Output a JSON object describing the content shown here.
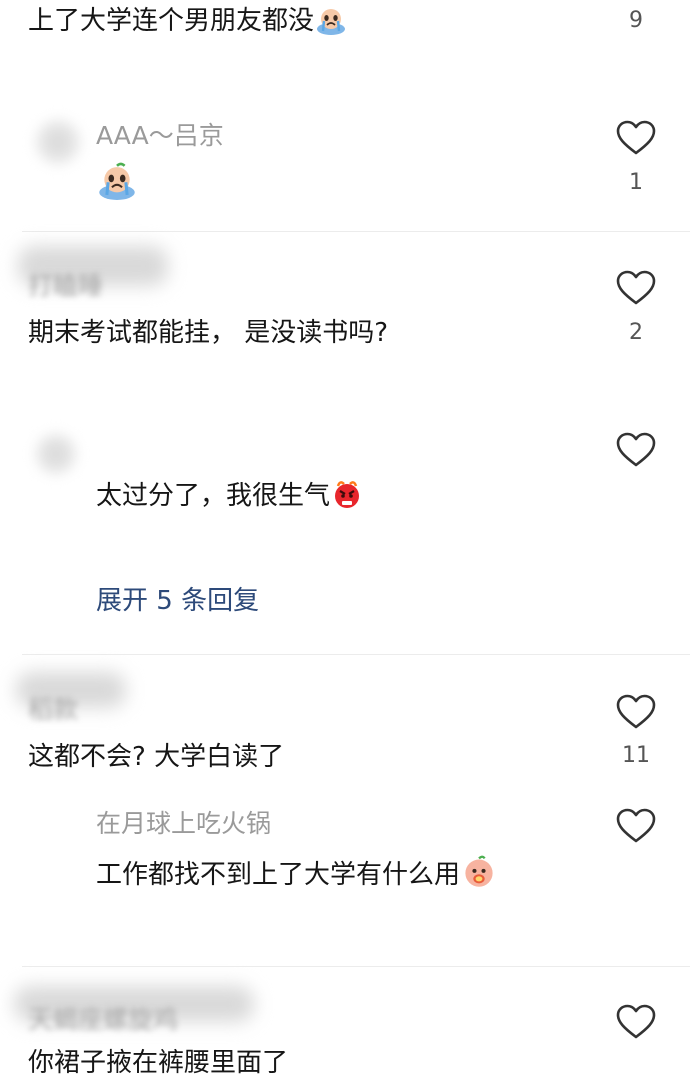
{
  "comments": [
    {
      "text": "上了大学连个男朋友都没",
      "emoji": "crying-face-emoji",
      "likes": "9"
    },
    {
      "username": "AAA～吕京",
      "emoji": "crying-face-emoji",
      "likes": "1"
    },
    {
      "username": "打瞌睡",
      "text": "期末考试都能挂， 是没读书吗?",
      "likes": "2",
      "reply_text": "太过分了，我很生气",
      "reply_emoji": "angry-face-emoji",
      "expand_label": "展开 5 条回复"
    },
    {
      "username": "稻款",
      "text": "这都不会? 大学白读了",
      "likes": "11",
      "reply_username": "在月球上吃火锅",
      "reply_text": "工作都找不到上了大学有什么用",
      "reply_emoji": "peach-face-emoji"
    },
    {
      "username": "天蝎座螺旋鸡",
      "text": "你裙子掖在裤腰里面了"
    }
  ],
  "colors": {
    "text": "#161616",
    "username": "#9a9a9a",
    "link": "#2d4a7a",
    "divider": "#ececec"
  }
}
